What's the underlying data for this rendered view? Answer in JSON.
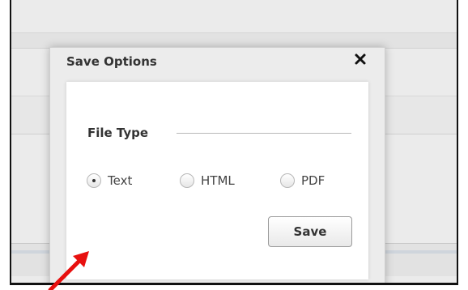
{
  "dialog": {
    "title": "Save Options",
    "close_icon": "close-icon"
  },
  "file_type": {
    "legend": "File Type",
    "options": [
      {
        "label": "Text",
        "checked": true
      },
      {
        "label": "HTML",
        "checked": false
      },
      {
        "label": "PDF",
        "checked": false
      }
    ]
  },
  "actions": {
    "save_label": "Save"
  },
  "annotation": {
    "arrow_icon": "red-arrow-icon",
    "arrow_color": "#e8100f"
  },
  "colors": {
    "dialog_bg": "#ececec",
    "panel_bg": "#ffffff",
    "text": "#333333"
  }
}
